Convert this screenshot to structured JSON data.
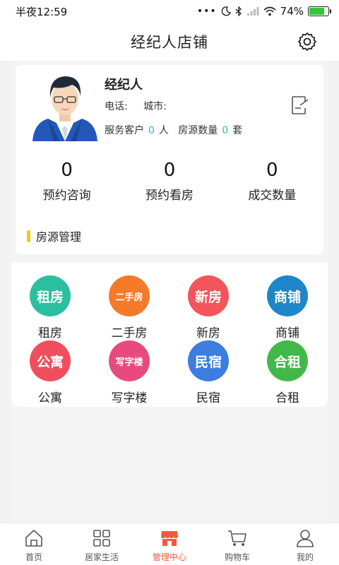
{
  "status_bar": {
    "time": "半夜12:59",
    "battery": "74%",
    "battery_level": 0.74
  },
  "header": {
    "title": "经纪人店铺",
    "settings_icon": "gear-icon"
  },
  "agent": {
    "name": "经纪人",
    "phone_label": "电话:",
    "city_label": "城市:",
    "clients_label": "服务客户",
    "clients_value": "0",
    "clients_unit": "人",
    "listings_label": "房源数量",
    "listings_value": "0",
    "listings_unit": "套"
  },
  "summary": [
    {
      "value": "0",
      "label": "预约咨询"
    },
    {
      "value": "0",
      "label": "预约看房"
    },
    {
      "value": "0",
      "label": "成交数量"
    }
  ],
  "section": {
    "title": "房源管理",
    "accent": "#f5c518"
  },
  "categories": [
    {
      "icon_text": "租房",
      "name": "租房",
      "color": "#2bbf9f"
    },
    {
      "icon_text": "二手房",
      "name": "二手房",
      "color": "#f47a2a"
    },
    {
      "icon_text": "新房",
      "name": "新房",
      "color": "#f2555a"
    },
    {
      "icon_text": "商铺",
      "name": "商铺",
      "color": "#1f86c9"
    },
    {
      "icon_text": "公寓",
      "name": "公寓",
      "color": "#ef4f5c"
    },
    {
      "icon_text": "写字楼",
      "name": "写字楼",
      "color": "#e84a7f"
    },
    {
      "icon_text": "民宿",
      "name": "民宿",
      "color": "#3d7de0"
    },
    {
      "icon_text": "合租",
      "name": "合租",
      "color": "#43b84a"
    }
  ],
  "nav": [
    {
      "label": "首页",
      "icon": "home-icon",
      "active": false
    },
    {
      "label": "居家生活",
      "icon": "grid-icon",
      "active": false
    },
    {
      "label": "管理中心",
      "icon": "store-icon",
      "active": true
    },
    {
      "label": "购物车",
      "icon": "cart-icon",
      "active": false
    },
    {
      "label": "我的",
      "icon": "user-icon",
      "active": false
    }
  ],
  "colors": {
    "active_nav": "#f05a3a",
    "stat_number": "#2bb6d9"
  }
}
